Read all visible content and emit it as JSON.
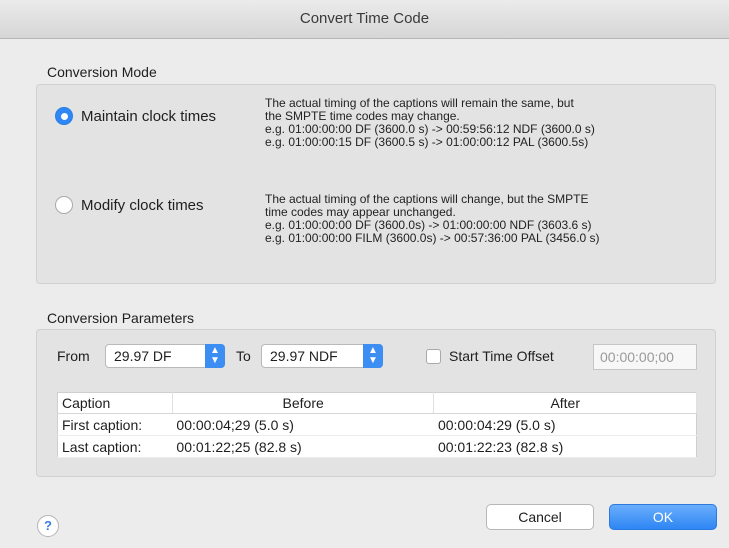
{
  "window": {
    "title": "Convert Time Code"
  },
  "conversion_mode": {
    "label": "Conversion Mode",
    "options": [
      {
        "label": "Maintain clock times",
        "selected": true,
        "description": [
          "The actual timing of the captions will remain the same, but",
          "the SMPTE time codes may change.",
          "e.g.  01:00:00:00 DF (3600.0 s) -> 00:59:56:12 NDF (3600.0 s)",
          "e.g. 01:00:00:15 DF (3600.5 s) -> 01:00:00:12 PAL (3600.5s)"
        ]
      },
      {
        "label": "Modify clock times",
        "selected": false,
        "description": [
          "The actual timing of the captions will change, but the SMPTE",
          "time codes may appear unchanged.",
          "e.g. 01:00:00:00 DF (3600.0s) -> 01:00:00:00 NDF (3603.6 s)",
          "e.g. 01:00:00:00 FILM (3600.0s) -> 00:57:36:00 PAL (3456.0 s)"
        ]
      }
    ]
  },
  "conversion_parameters": {
    "label": "Conversion Parameters",
    "from_label": "From",
    "from_value": "29.97 DF",
    "to_label": "To",
    "to_value": "29.97 NDF",
    "start_time_offset_label": "Start Time Offset",
    "start_time_offset_checked": false,
    "start_time_offset_value": "00:00:00;00",
    "table": {
      "columns": [
        "Caption",
        "Before",
        "After"
      ],
      "rows": [
        [
          "First caption:",
          "00:00:04;29 (5.0 s)",
          "00:00:04:29 (5.0 s)"
        ],
        [
          "Last caption:",
          "00:01:22;25 (82.8 s)",
          "00:01:22:23 (82.8 s)"
        ]
      ]
    }
  },
  "buttons": {
    "cancel": "Cancel",
    "ok": "OK",
    "help": "?"
  },
  "colors": {
    "accent": "#2f87f5",
    "window_bg": "#ececec",
    "box_bg": "#e3e3e3"
  }
}
